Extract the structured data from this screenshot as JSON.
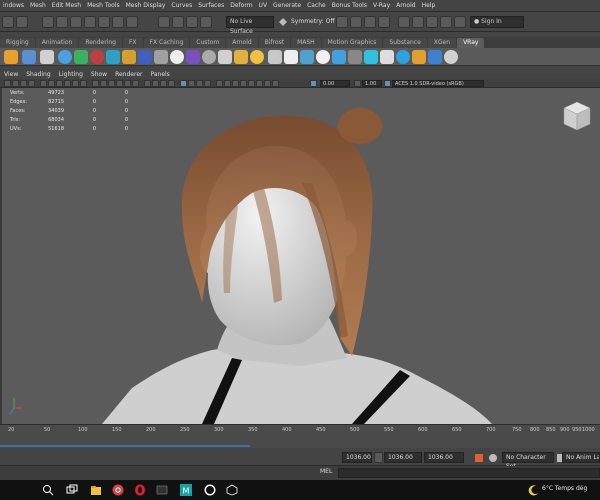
{
  "menubar": {
    "items": [
      "indows",
      "Mesh",
      "Edit Mesh",
      "Mesh Tools",
      "Mesh Display",
      "Curves",
      "Surfaces",
      "Deform",
      "UV",
      "Generate",
      "Cache",
      "Bonus Tools",
      "V-Ray",
      "Arnold",
      "Help"
    ]
  },
  "statusline": {
    "live_surface": "No Live Surface",
    "symmetry": "Symmetry: Off",
    "sign_in": "Sign In"
  },
  "shelf": {
    "tabs": [
      "Rigging",
      "Animation",
      "Rendering",
      "FX",
      "FX Caching",
      "Custom",
      "Arnold",
      "Bifrost",
      "MASH",
      "Motion Graphics",
      "Substance",
      "XGen",
      "VRay"
    ],
    "active_tab": "VRay"
  },
  "panel_menu": {
    "items": [
      "View",
      "Shading",
      "Lighting",
      "Show",
      "Renderer",
      "Panels"
    ]
  },
  "viewport_toolbar": {
    "value_a": "0.00",
    "value_b": "1.00",
    "color_space": "ACES 1.0 SDR-video (sRGB)"
  },
  "hud": {
    "rows": [
      {
        "label": "Verts:",
        "value": "49723",
        "sel": "0",
        "extra": "0"
      },
      {
        "label": "Edges:",
        "value": "82715",
        "sel": "0",
        "extra": "0"
      },
      {
        "label": "Faces:",
        "value": "34039",
        "sel": "0",
        "extra": "0"
      },
      {
        "label": "Tris:",
        "value": "68034",
        "sel": "0",
        "extra": "0"
      },
      {
        "label": "UVs:",
        "value": "51618",
        "sel": "0",
        "extra": "0"
      }
    ]
  },
  "timeslider": {
    "ticks": [
      "20",
      "50",
      "100",
      "150",
      "200",
      "250",
      "300",
      "350",
      "400",
      "450",
      "500",
      "550",
      "600",
      "650",
      "700",
      "750",
      "800",
      "850",
      "900",
      "950",
      "1000"
    ]
  },
  "range": {
    "start": "1036.00",
    "current": "1036.00",
    "end": "1036.00",
    "character_set": "No Character Set",
    "anim_layer": "No Anim Layer"
  },
  "mel": {
    "label": "MEL"
  },
  "taskbar": {
    "weather": "6°C  Temps dég"
  },
  "colors": {
    "ui_bg": "#444444",
    "viewport_bg": "#5b5b5b",
    "hair": "#8a5a38",
    "skin": "#d4d4d4",
    "accent_blue": "#3f6fa8"
  }
}
